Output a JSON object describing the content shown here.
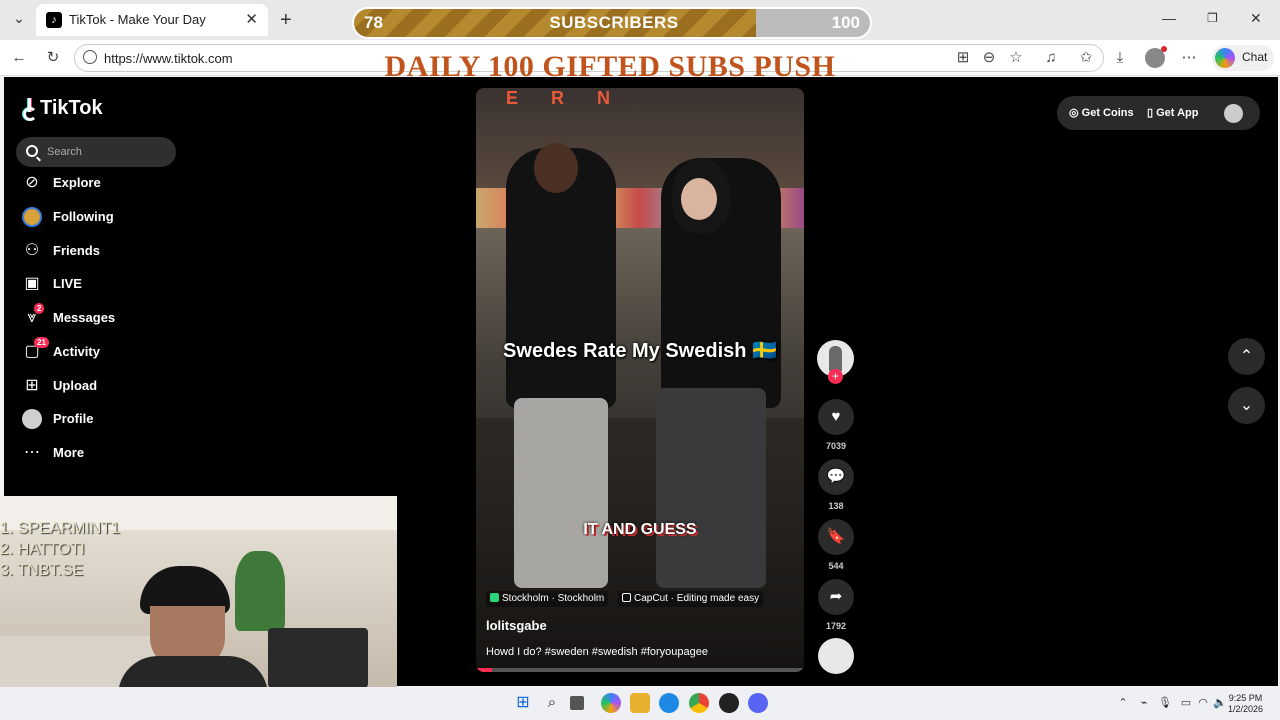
{
  "browser": {
    "tab_title": "TikTok - Make Your Day",
    "tab_favicon": "tiktok-icon",
    "url": "https://www.tiktok.com",
    "chat_label": "Chat"
  },
  "overlay": {
    "progress_current": "78",
    "progress_label": "SUBSCRIBERS",
    "progress_goal": "100",
    "progress_fraction": 0.78,
    "headline": "DAILY 100 GIFTED SUBS PUSH",
    "leaderboard": [
      "1.  SPEARMINT1",
      "2.   HATTOTI",
      "3.  TNBT.SE"
    ]
  },
  "tiktok": {
    "logo": "TikTok",
    "search_placeholder": "Search",
    "nav": [
      {
        "label": "Explore",
        "icon": "compass-icon"
      },
      {
        "label": "Following",
        "icon": "following-avatar-icon"
      },
      {
        "label": "Friends",
        "icon": "friends-icon"
      },
      {
        "label": "LIVE",
        "icon": "live-tv-icon"
      },
      {
        "label": "Messages",
        "icon": "messages-icon",
        "badge": "2"
      },
      {
        "label": "Activity",
        "icon": "activity-icon",
        "badge": "21"
      },
      {
        "label": "Upload",
        "icon": "upload-plus-icon"
      },
      {
        "label": "Profile",
        "icon": "profile-avatar-icon"
      },
      {
        "label": "More",
        "icon": "more-dots-icon"
      }
    ],
    "top_right": {
      "get_coins": "Get Coins",
      "get_app": "Get App"
    },
    "video": {
      "sign_text": "E R N",
      "title_overlay": "Swedes Rate My Swedish 🇸🇪",
      "caption_overlay": "IT AND GUESS",
      "location": "Stockholm · Stockholm",
      "capcut": "CapCut · Editing made easy",
      "username": "lolitsgabe",
      "description": "Howd I do? #sweden #swedish #foryoupagee",
      "progress_fraction": 0.05
    },
    "actions": {
      "likes": "7039",
      "comments": "138",
      "saves": "544",
      "shares": "1792"
    }
  },
  "taskbar": {
    "time": "9:25 PM",
    "date": "1/2/2026"
  },
  "colors": {
    "accent": "#fe2c55",
    "gold": "#b58a2e",
    "headline": "#c0541c"
  }
}
